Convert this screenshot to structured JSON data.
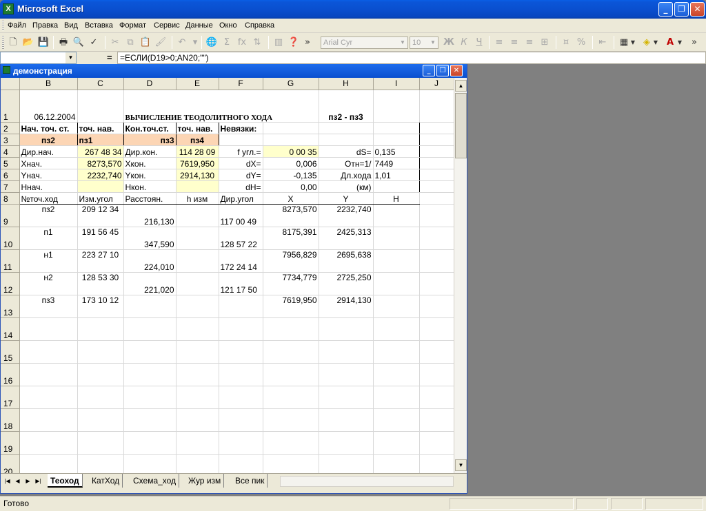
{
  "app": {
    "title": "Microsoft Excel",
    "icon": "X"
  },
  "window_buttons": [
    "_",
    "❐",
    "✕"
  ],
  "menu": [
    "Файл",
    "Правка",
    "Вид",
    "Вставка",
    "Формат",
    "Сервис",
    "Данные",
    "Окно",
    "Справка"
  ],
  "toolbar": {
    "font_name": "Arial Cyr",
    "font_size": "10",
    "bold": "Ж",
    "italic": "К",
    "underline": "Ч",
    "percent": "%",
    "sigma": "Σ",
    "fx": "fx",
    "overflow": "»"
  },
  "formula_bar": {
    "name_box": "",
    "eq_sign": "=",
    "formula": "=ЕСЛИ(D19>0;AN20;\"\")"
  },
  "workbook": {
    "title": "демонстрация",
    "columns": [
      "B",
      "C",
      "D",
      "E",
      "F",
      "G",
      "H",
      "I",
      "J"
    ],
    "rows": {
      "r1": {
        "num": "1",
        "B": "06.12.2004",
        "D": "ВЫЧИСЛЕНИЕ ТЕОДОЛИТНОГО ХОДА",
        "H": "пз2 - пз3"
      },
      "r2": {
        "num": "2",
        "B": "Нач. точ. ст.",
        "C": "точ. нав.",
        "D": "Кон.точ.ст.",
        "E": "точ. нав.",
        "F": "Невязки:"
      },
      "r3": {
        "num": "3",
        "B": "пз2",
        "C": "пз1",
        "D": "пз3",
        "E": "пз4"
      },
      "r4": {
        "num": "4",
        "B": "Дир.нач.",
        "C": "267 48 34",
        "D": "Дир.кон.",
        "E": "114 28 09",
        "F": "f угл.=",
        "G": "0 00 35",
        "H": "dS=",
        "I": "0,135"
      },
      "r5": {
        "num": "5",
        "B": "Хнач.",
        "C": "8273,570",
        "D": "Хкон.",
        "E": "7619,950",
        "F": "dX=",
        "G": "0,006",
        "H": "Отн=1/",
        "I": "7449"
      },
      "r6": {
        "num": "6",
        "B": "Yнач.",
        "C": "2232,740",
        "D": "Yкон.",
        "E": "2914,130",
        "F": "dY=",
        "G": "-0,135",
        "H": "Дл.хода",
        "I": "1,01"
      },
      "r7": {
        "num": "7",
        "B": "Ннач.",
        "D": "Нкон.",
        "F": "dH=",
        "G": "0,00",
        "H": "(км)"
      },
      "r8": {
        "num": "8",
        "B": "№точ.ход",
        "C": "Изм.угол",
        "D": "Расстоян.",
        "E": "h изм",
        "F": "Дир.угол",
        "G": "X",
        "H": "Y",
        "I": "H"
      },
      "r9": {
        "num": "9",
        "B": "пз2",
        "C": "209 12 34",
        "D": "216,130",
        "F": "117 00 49",
        "G": "8273,570",
        "H": "2232,740"
      },
      "r10": {
        "num": "10",
        "B": "п1",
        "C": "191 56 45",
        "D": "347,590",
        "F": "128 57 22",
        "G": "8175,391",
        "H": "2425,313"
      },
      "r11": {
        "num": "11",
        "B": "н1",
        "C": "223 27 10",
        "D": "224,010",
        "F": "172 24 14",
        "G": "7956,829",
        "H": "2695,638"
      },
      "r12": {
        "num": "12",
        "B": "н2",
        "C": "128 53 30",
        "D": "221,020",
        "F": "121 17 50",
        "G": "7734,779",
        "H": "2725,250"
      },
      "r13": {
        "num": "13",
        "B": "пз3",
        "C": "173 10 12",
        "G": "7619,950",
        "H": "2914,130"
      },
      "r14": {
        "num": "14"
      },
      "r15": {
        "num": "15"
      },
      "r16": {
        "num": "16"
      },
      "r17": {
        "num": "17"
      },
      "r18": {
        "num": "18"
      },
      "r19": {
        "num": "19"
      },
      "r20": {
        "num": "20"
      }
    },
    "sheet_tabs": [
      "Теоход",
      "КатХод",
      "Схема_ход",
      "Жур изм",
      "Все пик"
    ],
    "tab_nav": [
      "|◀",
      "◀",
      "▶",
      "▶|"
    ]
  },
  "status": {
    "text": "Готово"
  },
  "colors": {
    "orange_fill": "#fcd5b4",
    "yellow_fill": "#ffffcc",
    "title_blue": "#0a4fcf"
  }
}
